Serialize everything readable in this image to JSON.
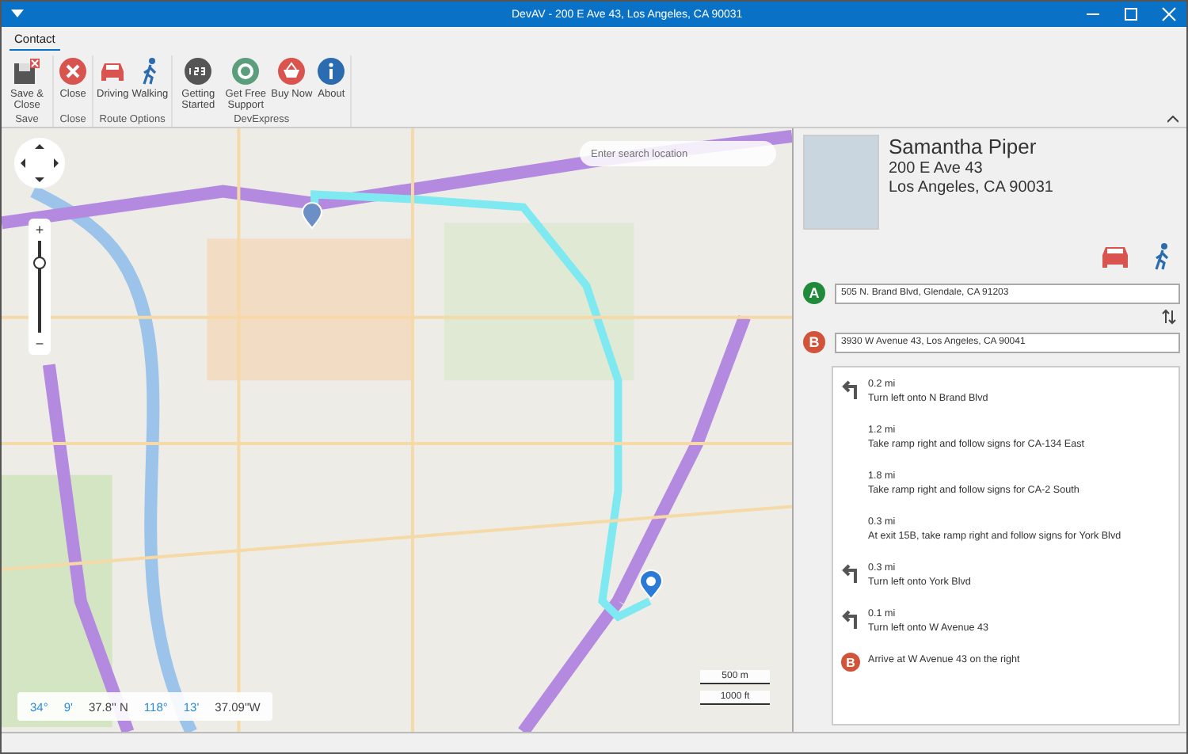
{
  "window": {
    "title": "DevAV - 200 E Ave 43, Los Angeles, CA 90031"
  },
  "ribbon": {
    "tabs": [
      {
        "label": "Contact",
        "selected": true
      }
    ],
    "groups": [
      {
        "label": "Save",
        "buttons": [
          {
            "label": "Save & Close",
            "kind": "save"
          }
        ]
      },
      {
        "label": "Close",
        "buttons": [
          {
            "label": "Close",
            "kind": "close"
          }
        ]
      },
      {
        "label": "Route Options",
        "buttons": [
          {
            "label": "Driving",
            "kind": "car"
          },
          {
            "label": "Walking",
            "kind": "walk"
          }
        ]
      },
      {
        "label": "DevExpress",
        "buttons": [
          {
            "label": "Getting Started",
            "kind": "start"
          },
          {
            "label": "Get Free Support",
            "kind": "support"
          },
          {
            "label": "Buy Now",
            "kind": "buy"
          },
          {
            "label": "About",
            "kind": "about"
          }
        ]
      }
    ]
  },
  "map": {
    "search": {
      "placeholder": "Enter search location"
    },
    "coordinates": [
      {
        "text": "34°",
        "highlighted": true
      },
      {
        "text": "9'",
        "highlighted": true
      },
      {
        "text": "37.8'' N",
        "highlighted": false
      },
      {
        "text": "118°",
        "highlighted": true
      },
      {
        "text": "13'",
        "highlighted": true
      },
      {
        "text": "37.09''W",
        "highlighted": false
      }
    ],
    "scale": [
      "500 m",
      "1000 ft"
    ],
    "zoom": {
      "plus": "+",
      "minus": "−",
      "level": 0.76
    }
  },
  "contact": {
    "name": "Samantha Piper",
    "address_line_1": "200 E Ave 43",
    "address_line_2": "Los Angeles, CA 90031"
  },
  "route": {
    "from_marker": "A",
    "from": "505 N. Brand Blvd, Glendale, CA 91203",
    "to_marker": "B",
    "to": "3930 W Avenue 43, Los Angeles, CA 90041",
    "steps": [
      {
        "kind": "turn-left",
        "distance": "0.2 mi",
        "instruction": "Turn left onto N Brand Blvd"
      },
      {
        "kind": "plain",
        "distance": "1.2 mi",
        "instruction": "Take ramp right and follow signs for CA-134 East"
      },
      {
        "kind": "plain",
        "distance": "1.8 mi",
        "instruction": "Take ramp right and follow signs for CA-2 South"
      },
      {
        "kind": "plain",
        "distance": "0.3 mi",
        "instruction": "At exit 15B, take ramp right and follow signs for York Blvd"
      },
      {
        "kind": "turn-left",
        "distance": "0.3 mi",
        "instruction": "Turn left onto York Blvd"
      },
      {
        "kind": "turn-left",
        "distance": "0.1 mi",
        "instruction": "Turn left onto W Avenue 43"
      },
      {
        "kind": "arrive",
        "marker": "B",
        "instruction": "Arrive at W Avenue 43 on the right"
      }
    ]
  }
}
